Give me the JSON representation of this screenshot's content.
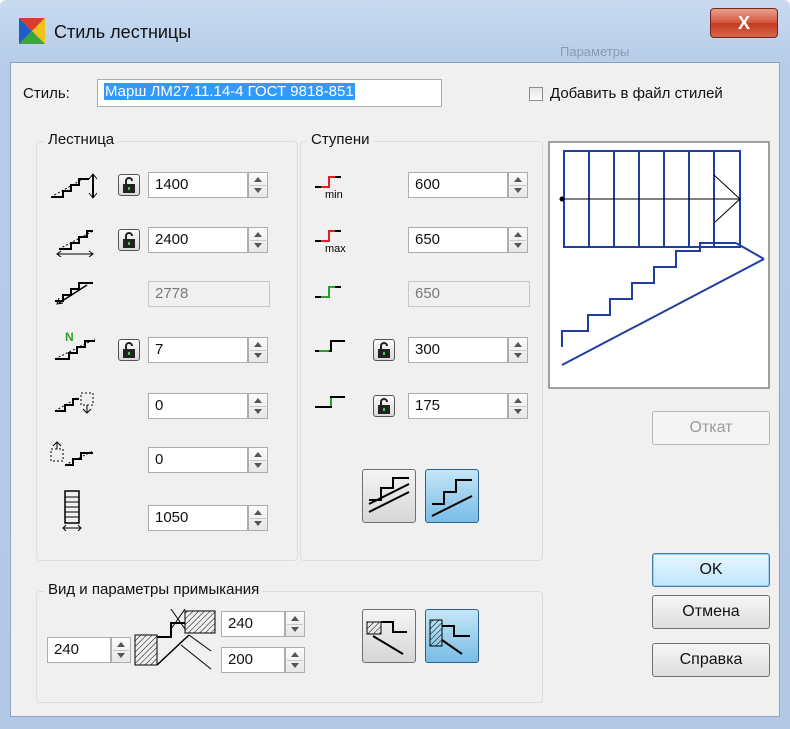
{
  "window": {
    "title": "Стиль лестницы",
    "ghost_title": "Параметры",
    "close_glyph": "X"
  },
  "style_row": {
    "label": "Стиль:",
    "value": "Марш ЛМ27.11.14-4 ГОСТ 9818-851",
    "add_to_file_label": "Добавить в файл стилей",
    "add_to_file_checked": false
  },
  "stair_group": {
    "title": "Лестница",
    "rows": [
      {
        "icon": "stair-height-icon",
        "locked": true,
        "value": "1400",
        "enabled": true
      },
      {
        "icon": "stair-length-icon",
        "locked": true,
        "value": "2400",
        "enabled": true
      },
      {
        "icon": "stair-slope-length-icon",
        "locked": false,
        "value": "2778",
        "enabled": false
      },
      {
        "icon": "stair-step-count-icon",
        "locked": true,
        "value": "7",
        "enabled": true,
        "badge": "N"
      },
      {
        "icon": "stair-top-offset-icon",
        "locked": false,
        "value": "0",
        "enabled": true
      },
      {
        "icon": "stair-bottom-offset-icon",
        "locked": false,
        "value": "0",
        "enabled": true
      },
      {
        "icon": "stair-width-icon",
        "locked": false,
        "value": "1050",
        "enabled": true
      }
    ]
  },
  "steps_group": {
    "title": "Ступени",
    "rows": [
      {
        "icon": "step-min-icon",
        "sub": "min",
        "locked": false,
        "value": "600",
        "enabled": true
      },
      {
        "icon": "step-max-icon",
        "sub": "max",
        "locked": false,
        "value": "650",
        "enabled": true
      },
      {
        "icon": "step-actual-icon",
        "locked": false,
        "value": "650",
        "enabled": false
      },
      {
        "icon": "step-tread-icon",
        "locked": true,
        "value": "300",
        "enabled": true
      },
      {
        "icon": "step-riser-icon",
        "locked": true,
        "value": "175",
        "enabled": true
      }
    ]
  },
  "junction_group": {
    "title": "Вид и параметры примыкания",
    "left_value": "240",
    "top_value": "240",
    "bottom_value": "200"
  },
  "buttons": {
    "rollback": "Откат",
    "ok": "OK",
    "cancel": "Отмена",
    "help": "Справка"
  },
  "colors": {
    "accent_red": "#e02020",
    "accent_green": "#2aa02a",
    "preview_blue": "#1f3fa0",
    "selection": "#3399ff"
  }
}
